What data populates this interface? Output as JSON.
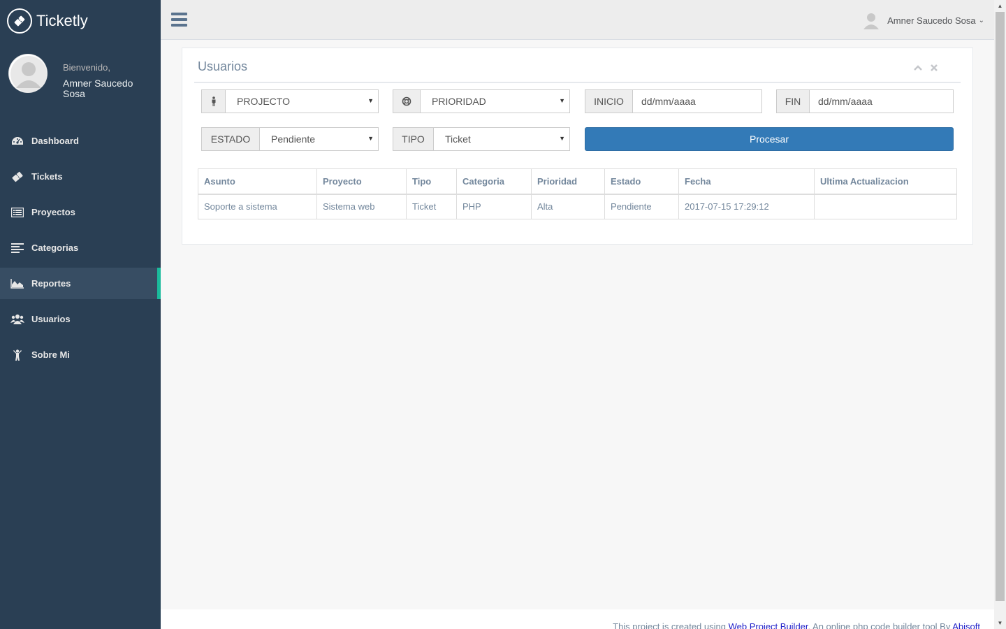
{
  "brand": {
    "title": "Ticketly"
  },
  "profile": {
    "welcome": "Bienvenido,",
    "name": "Amner Saucedo Sosa"
  },
  "sidebar": {
    "items": [
      {
        "label": "Dashboard",
        "icon": "dashboard-icon"
      },
      {
        "label": "Tickets",
        "icon": "ticket-icon"
      },
      {
        "label": "Proyectos",
        "icon": "list-icon"
      },
      {
        "label": "Categorias",
        "icon": "align-left-icon"
      },
      {
        "label": "Reportes",
        "icon": "area-chart-icon",
        "active": true
      },
      {
        "label": "Usuarios",
        "icon": "users-icon"
      },
      {
        "label": "Sobre Mi",
        "icon": "child-icon"
      }
    ]
  },
  "topnav": {
    "user_name": "Amner Saucedo Sosa"
  },
  "panel": {
    "title": "Usuarios",
    "filters": {
      "proyecto": "PROJECTO",
      "prioridad": "PRIORIDAD",
      "inicio_label": "INICIO",
      "inicio_placeholder": "dd/mm/aaaa",
      "fin_label": "FIN",
      "fin_placeholder": "dd/mm/aaaa",
      "estado_label": "ESTADO",
      "estado_value": "Pendiente",
      "tipo_label": "TIPO",
      "tipo_value": "Ticket"
    },
    "process_label": "Procesar"
  },
  "table": {
    "headers": [
      "Asunto",
      "Proyecto",
      "Tipo",
      "Categoria",
      "Prioridad",
      "Estado",
      "Fecha",
      "Ultima Actualizacion"
    ],
    "rows": [
      [
        "Soporte a sistema",
        "Sistema web",
        "Ticket",
        "PHP",
        "Alta",
        "Pendiente",
        "2017-07-15 17:29:12",
        ""
      ]
    ]
  },
  "footer": {
    "prefix": "This project is created using ",
    "link1": "Web Project Builder",
    "middle": ". An online php code builder tool By ",
    "link2": "Abisoft"
  },
  "colors": {
    "sidebar": "#2A3F54",
    "accent": "#1ABB9C",
    "primary": "#337AB7"
  }
}
